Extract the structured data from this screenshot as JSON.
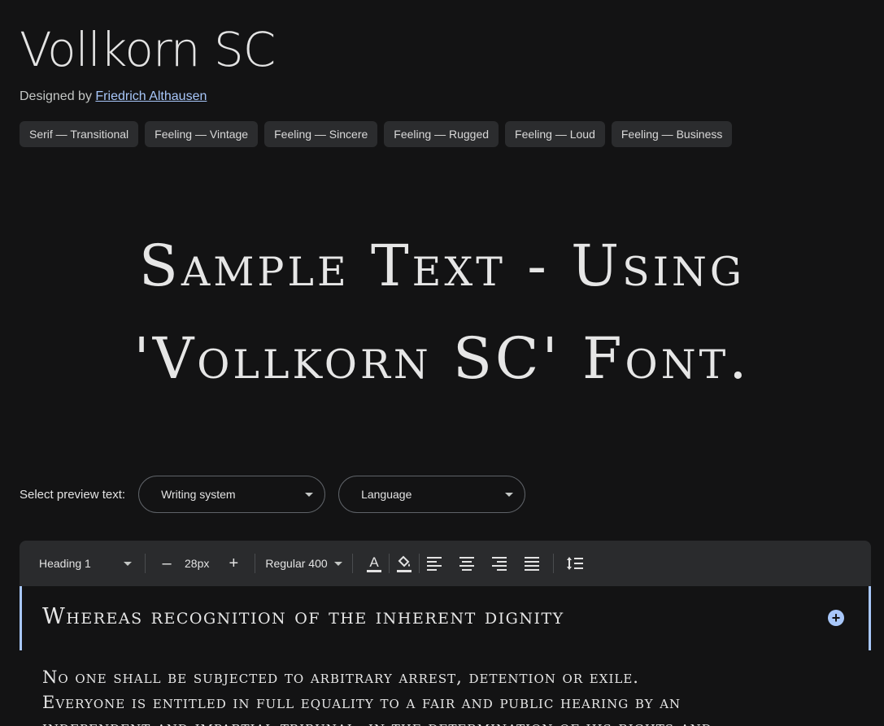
{
  "font": {
    "name": "Vollkorn SC",
    "designed_by_label": "Designed by",
    "designer": "Friedrich Althausen"
  },
  "tags": [
    "Serif — Transitional",
    "Feeling — Vintage",
    "Feeling — Sincere",
    "Feeling — Rugged",
    "Feeling — Loud",
    "Feeling — Business"
  ],
  "hero": {
    "line1": "Sample Text - Using",
    "line2": "'Vollkorn SC' Font."
  },
  "preview": {
    "label": "Select preview text:",
    "writing_system": "Writing system",
    "language": "Language"
  },
  "toolbar": {
    "style": "Heading 1",
    "decrease": "–",
    "size": "28px",
    "increase": "+",
    "weight": "Regular 400"
  },
  "editor": {
    "heading": "Whereas recognition of the inherent dignity",
    "body": [
      "No one shall be subjected to arbitrary arrest, detention or exile.",
      "Everyone is entitled in full equality to a fair and public hearing by an",
      "independent and impartial tribunal, in the determination of his rights and"
    ]
  },
  "colors": {
    "background": "#131314",
    "accent": "#a8c7fa",
    "toolbar": "#2a2b2d"
  },
  "icons": [
    "chevron-down-icon",
    "text-color-icon",
    "highlight-icon",
    "align-left-icon",
    "align-center-icon",
    "align-right-icon",
    "align-justify-icon",
    "line-spacing-icon",
    "add-icon"
  ]
}
